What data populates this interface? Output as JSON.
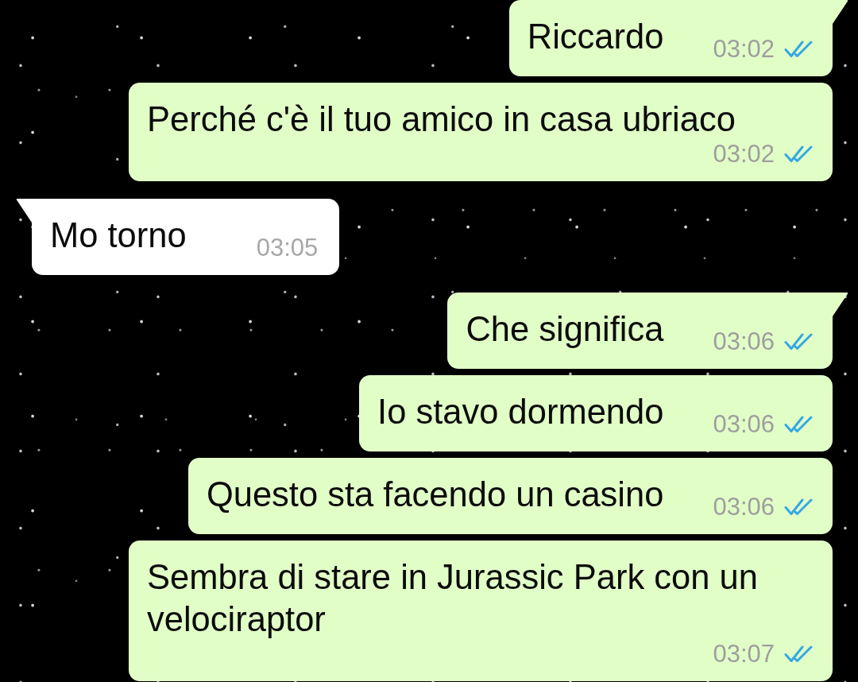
{
  "messages": [
    {
      "kind": "outgoing",
      "tail": true,
      "text": "Riccardo",
      "time": "03:02",
      "read": true
    },
    {
      "kind": "outgoing",
      "tail": false,
      "text": "Perché c'è il tuo amico in casa ubriaco",
      "time": "03:02",
      "read": true
    },
    {
      "kind": "incoming",
      "tail": true,
      "text": "Mo torno",
      "time": "03:05"
    },
    {
      "kind": "outgoing",
      "tail": true,
      "text": "Che significa",
      "time": "03:06",
      "read": true
    },
    {
      "kind": "outgoing",
      "tail": false,
      "text": "Io stavo dormendo",
      "time": "03:06",
      "read": true
    },
    {
      "kind": "outgoing",
      "tail": false,
      "text": "Questo sta facendo un casino",
      "time": "03:06",
      "read": true
    },
    {
      "kind": "outgoing",
      "tail": false,
      "text": "Sembra di stare in Jurassic Park con un velociraptor",
      "time": "03:07",
      "read": true
    }
  ]
}
